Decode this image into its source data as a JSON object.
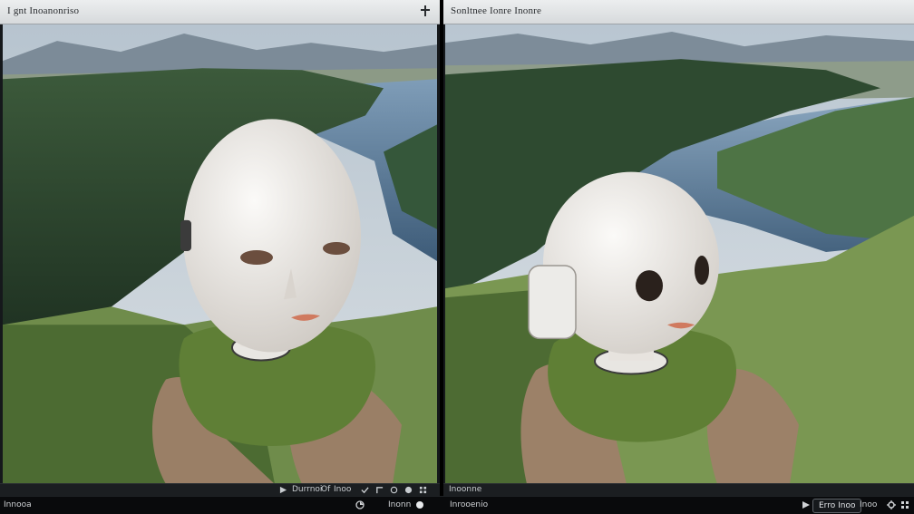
{
  "left_pane": {
    "title": "I gnt Inoanonriso",
    "status": {
      "label_a": "Durrnoi",
      "label_b": "Of",
      "label_c": "Inoo"
    }
  },
  "right_pane": {
    "title": "Sonltnee Ionre Inonre",
    "status": {
      "label_a": "Inoonne"
    }
  },
  "bottom_bar": {
    "left_text": "Innooa",
    "mid_left_text": "Inonn",
    "right_left_text": "Inrooenio",
    "button_label": "Erro Inoo",
    "far_right_text": "Inoo"
  },
  "icons": {
    "left_pin": "pin-icon",
    "arrow": "arrow-icon",
    "circle": "circle-icon",
    "gear": "gear-icon",
    "record": "record-icon",
    "grid": "grid-icon"
  }
}
